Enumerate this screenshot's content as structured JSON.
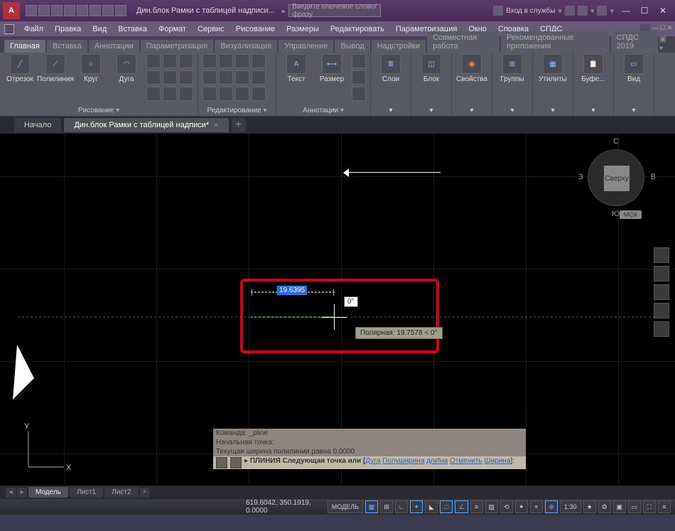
{
  "title": "Дин.блок Рамки с таблицей надписи...",
  "search_placeholder": "Введите ключевое слово/фразу",
  "signin": "Вход в службы",
  "menu": [
    "Файл",
    "Правка",
    "Вид",
    "Вставка",
    "Формат",
    "Сервис",
    "Рисование",
    "Размеры",
    "Редактировать",
    "Параметризация",
    "Окно",
    "Справка",
    "СПДС"
  ],
  "ribbon_tabs": [
    "Главная",
    "Вставка",
    "Аннотации",
    "Параметризация",
    "Визуализация",
    "Управление",
    "Вывод",
    "Надстройки",
    "Совместная работа",
    "Рекомендованные приложения",
    "СПДС 2019"
  ],
  "panels": {
    "draw": {
      "title": "Рисование",
      "btns": [
        "Отрезок",
        "Полилиния",
        "Круг",
        "Дуга"
      ]
    },
    "edit": {
      "title": "Редактирование"
    },
    "anno": {
      "title": "Аннотации",
      "btns": [
        "Текст",
        "Размер"
      ]
    },
    "layers": {
      "title": "Слои"
    },
    "block": {
      "title": "Блок"
    },
    "prop": {
      "title": "Свойства"
    },
    "groups": {
      "title": "Группы"
    },
    "util": {
      "title": "Утилиты"
    },
    "clip": {
      "title": "Буфе..."
    },
    "view": {
      "title": "Вид"
    }
  },
  "doc_tabs": {
    "home": "Начало",
    "active": "Дин.блок Рамки с таблицей надписи*"
  },
  "viewcube": {
    "face": "Сверху",
    "n": "С",
    "s": "Ю",
    "e": "В",
    "w": "З",
    "wcs": "МСК"
  },
  "dynamic_input": {
    "distance": "19.6395",
    "angle": "0°",
    "tooltip": "Полярная: 19.7578 < 0°"
  },
  "ucs": {
    "x": "X",
    "y": "Y"
  },
  "command": {
    "hist1": "Команда: _pline",
    "hist2": "Начальная точка:",
    "hist3": "Текущая ширина полилинии равна 0.0000",
    "prompt_pre": "ПЛИНИЯ Следующая точка или [",
    "opts": [
      "Дуга",
      "Полуширина",
      "длИна",
      "Отменить",
      "Ширина"
    ],
    "prompt_post": "]:"
  },
  "btm_tabs": [
    "Модель",
    "Лист1",
    "Лист2"
  ],
  "status": {
    "coords": "619.6042, 350.1919, 0.0000",
    "space": "МОДЕЛЬ",
    "scale": "1:30",
    "extra": "+"
  }
}
